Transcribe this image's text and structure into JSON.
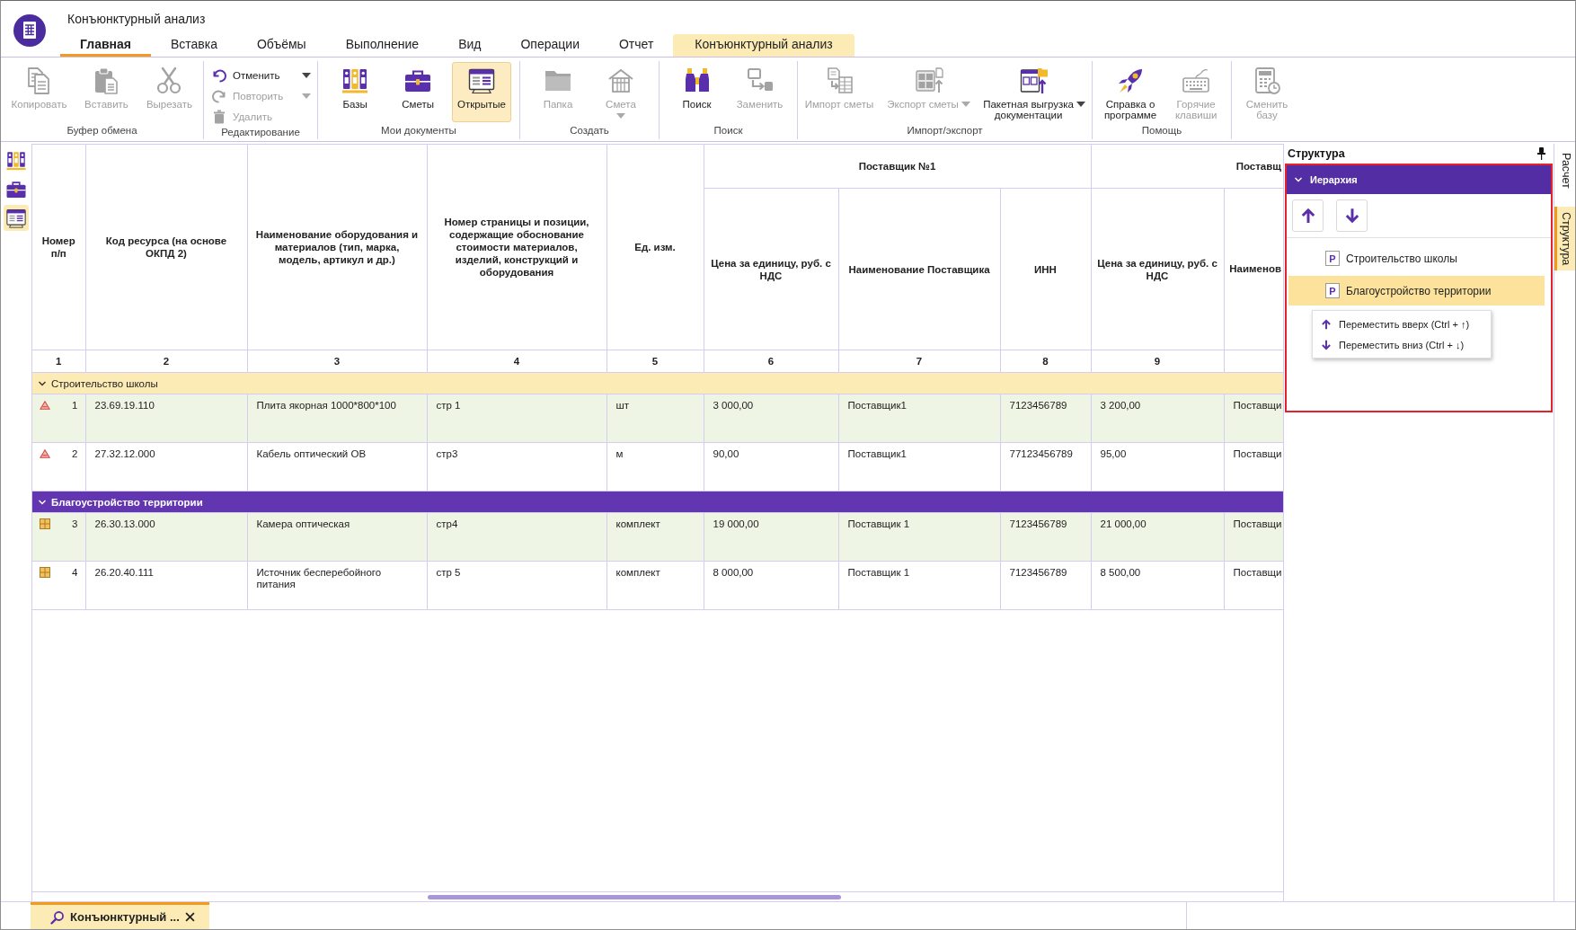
{
  "window": {
    "title": "Конъюнктурный анализ"
  },
  "tabs": [
    {
      "label": "Главная",
      "selected": true,
      "kind": "normal"
    },
    {
      "label": "Вставка",
      "selected": false,
      "kind": "normal"
    },
    {
      "label": "Объёмы",
      "selected": false,
      "kind": "normal"
    },
    {
      "label": "Выполнение",
      "selected": false,
      "kind": "normal"
    },
    {
      "label": "Вид",
      "selected": false,
      "kind": "normal"
    },
    {
      "label": "Операции",
      "selected": false,
      "kind": "normal"
    },
    {
      "label": "Отчет",
      "selected": false,
      "kind": "normal"
    },
    {
      "label": "Конъюнктурный анализ",
      "selected": false,
      "kind": "contextual"
    }
  ],
  "ribbon": {
    "groups": [
      {
        "label": "Буфер обмена",
        "buttons": [
          {
            "kind": "large",
            "label": "Копировать",
            "disabled": true
          },
          {
            "kind": "large",
            "label": "Вставить",
            "disabled": true
          },
          {
            "kind": "large",
            "label": "Вырезать",
            "disabled": true
          }
        ]
      },
      {
        "label": "Редактирование",
        "buttons": [
          {
            "kind": "small",
            "label": "Отменить",
            "disabled": false,
            "dropdown": true
          },
          {
            "kind": "small",
            "label": "Повторить",
            "disabled": true,
            "dropdown": true
          },
          {
            "kind": "small",
            "label": "Удалить",
            "disabled": true
          }
        ]
      },
      {
        "label": "Мои документы",
        "buttons": [
          {
            "kind": "large",
            "label": "Базы",
            "disabled": false,
            "selected": false
          },
          {
            "kind": "large",
            "label": "Сметы",
            "disabled": false,
            "selected": false
          },
          {
            "kind": "large",
            "label": "Открытые",
            "disabled": false,
            "selected": true
          }
        ]
      },
      {
        "label": "Создать",
        "buttons": [
          {
            "kind": "large",
            "label": "Папка",
            "disabled": true
          },
          {
            "kind": "split",
            "label": "Смета",
            "disabled": true
          }
        ]
      },
      {
        "label": "Поиск",
        "buttons": [
          {
            "kind": "large",
            "label": "Поиск",
            "disabled": false
          },
          {
            "kind": "large",
            "label": "Заменить",
            "disabled": true
          }
        ]
      },
      {
        "label": "Импорт/экспорт",
        "buttons": [
          {
            "kind": "large",
            "label": "Импорт сметы",
            "disabled": true
          },
          {
            "kind": "large",
            "label": "Экспорт сметы",
            "disabled": true,
            "dropdown": true
          },
          {
            "kind": "large",
            "label": "Пакетная выгрузка\nдокументации",
            "disabled": false,
            "dropdown": true
          }
        ]
      },
      {
        "label": "Помощь",
        "buttons": [
          {
            "kind": "large",
            "label": "Справка о\nпрограмме",
            "disabled": false
          },
          {
            "kind": "large",
            "label": "Горячие\nклавиши",
            "disabled": true
          }
        ]
      },
      {
        "buttons": [
          {
            "kind": "large",
            "label": "Сменить\nбазу",
            "disabled": true
          }
        ]
      }
    ]
  },
  "side_toolbar": {
    "items": [
      {
        "kind": "bases",
        "selected": false
      },
      {
        "kind": "estimates",
        "selected": false
      },
      {
        "kind": "open",
        "selected": true
      }
    ]
  },
  "table": {
    "fixed_columns": [
      "Номер п/п",
      "Код ресурса (на основе ОКПД 2)",
      "Наименование оборудования и материалов (тип, марка, модель, артикул и др.)",
      "Номер страницы и позиции, содержащие обоснование стоимости материалов, изделий, конструкций и оборудования",
      "Ед. изм."
    ],
    "supplier_groups": [
      {
        "label": "Поставщик №1",
        "columns": [
          "Цена за единицу, руб. с НДС",
          "Наименование Поставщика",
          "ИНН"
        ]
      },
      {
        "label": "Поставщ",
        "columns": [
          "Цена за единицу, руб. с НДС",
          "Наименов"
        ]
      }
    ],
    "column_numbers": [
      "1",
      "2",
      "3",
      "4",
      "5",
      "6",
      "7",
      "8",
      "9"
    ],
    "groups": [
      {
        "label": "Строительство школы",
        "expanded": true,
        "selected": false,
        "rows": [
          {
            "kind": "material",
            "highlighted": true,
            "cells": [
              "1",
              "23.69.19.110",
              "Плита якорная 1000*800*100",
              "стр 1",
              "шт",
              "3 000,00",
              "Поставщик1",
              "7123456789",
              "3 200,00",
              "Поставщи"
            ]
          },
          {
            "kind": "material",
            "highlighted": false,
            "cells": [
              "2",
              "27.32.12.000",
              "Кабель оптический ОВ",
              "стр3",
              "м",
              "90,00",
              "Поставщик1",
              "77123456789",
              "95,00",
              "Поставщи"
            ]
          }
        ]
      },
      {
        "label": "Благоустройство территории",
        "expanded": true,
        "selected": true,
        "rows": [
          {
            "kind": "equipment",
            "highlighted": true,
            "cells": [
              "3",
              "26.30.13.000",
              "Камера оптическая",
              "стр4",
              "комплект",
              "19 000,00",
              "Поставщик 1",
              "7123456789",
              "21 000,00",
              "Поставщи"
            ]
          },
          {
            "kind": "equipment",
            "highlighted": false,
            "cells": [
              "4",
              "26.20.40.111",
              "Источник бесперебойного питания",
              "стр 5",
              "комплект",
              "8 000,00",
              "Поставщик 1",
              "7123456789",
              "8 500,00",
              "Поставщи"
            ]
          }
        ]
      }
    ]
  },
  "structure_panel": {
    "title": "Структура",
    "section": {
      "label": "Иерархия",
      "expanded": true,
      "outlined": true
    },
    "tree": [
      {
        "badge": "Р",
        "label": "Строительство школы",
        "selected": false
      },
      {
        "badge": "Р",
        "label": "Благоустройство территории",
        "selected": true
      }
    ],
    "context_menu": [
      {
        "kind": "up",
        "label": "Переместить вверх (Ctrl + ↑)"
      },
      {
        "kind": "down",
        "label": "Переместить вниз (Ctrl + ↓)"
      }
    ]
  },
  "side_tabs": [
    {
      "label": "Расчет",
      "selected": false
    },
    {
      "label": "Структура",
      "selected": true
    }
  ],
  "document_tabs": [
    {
      "label": "Конъюнктурный ...",
      "selected": true
    }
  ]
}
